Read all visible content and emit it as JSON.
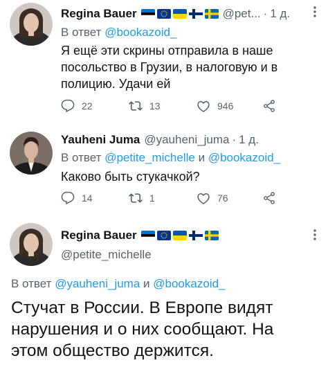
{
  "tweet1": {
    "name": "Regina Bauer",
    "handle": "@pet...",
    "dot": "·",
    "time": "1 д.",
    "reply_prefix": "В ответ",
    "reply_handle": "@bookazoid_",
    "text_lines": [
      "Я ещё эти скрины отправила в наше",
      "посольство в Грузии, в налоговую и в",
      "полицию. Удачи ей"
    ],
    "counts": {
      "replies": "22",
      "retweets": "13",
      "likes": "946"
    },
    "flags": [
      "flag-estonia",
      "flag-eu",
      "flag-ukraine",
      "flag-finland",
      "flag-sweden"
    ]
  },
  "tweet2": {
    "name": "Yauheni Juma",
    "handle": "@yauheni_juma",
    "dot": "·",
    "time": "1 д.",
    "reply_prefix": "В ответ",
    "reply_handle_1": "@petite_michelle",
    "reply_and": "и",
    "reply_handle_2": "@bookazoid_",
    "text": "Каково быть стукачкой?",
    "counts": {
      "replies": "14",
      "retweets": "1",
      "likes": "76"
    }
  },
  "tweet3": {
    "name": "Regina Bauer",
    "handle": "@petite_michelle",
    "reply_prefix": "В ответ",
    "reply_handle_1": "@yauheni_juma",
    "reply_and": "и",
    "reply_handle_2": "@bookazoid_",
    "text_lines": [
      "Стучат в России. В Европе видят",
      "нарушения и о них сообщают. На",
      "этом общество держится."
    ],
    "flags": [
      "flag-estonia",
      "flag-eu",
      "flag-ukraine",
      "flag-finland",
      "flag-sweden"
    ]
  },
  "colors": {
    "link": "#1d9bf0",
    "muted": "#536471",
    "text": "#0f1419"
  },
  "icons": [
    "reply-icon",
    "retweet-icon",
    "like-icon",
    "share-icon",
    "more-icon"
  ]
}
